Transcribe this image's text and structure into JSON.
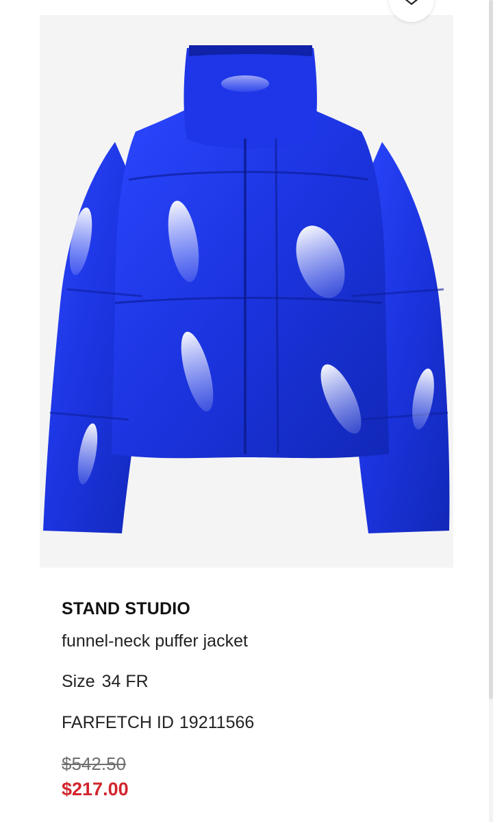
{
  "product": {
    "brand": "STAND STUDIO",
    "name": "funnel-neck puffer jacket",
    "size_label": "Size",
    "size_value": "34 FR",
    "id_label": "FARFETCH ID",
    "id_value": "19211566",
    "original_price": "$542.50",
    "sale_price": "$217.00"
  },
  "image": {
    "icon": "product-photo-blue-puffer-jacket"
  },
  "controls": {
    "close_icon": "close-icon"
  },
  "colors": {
    "sale_price": "#d2242c",
    "jacket": "#1f3be0",
    "image_background": "#f4f4f4"
  }
}
